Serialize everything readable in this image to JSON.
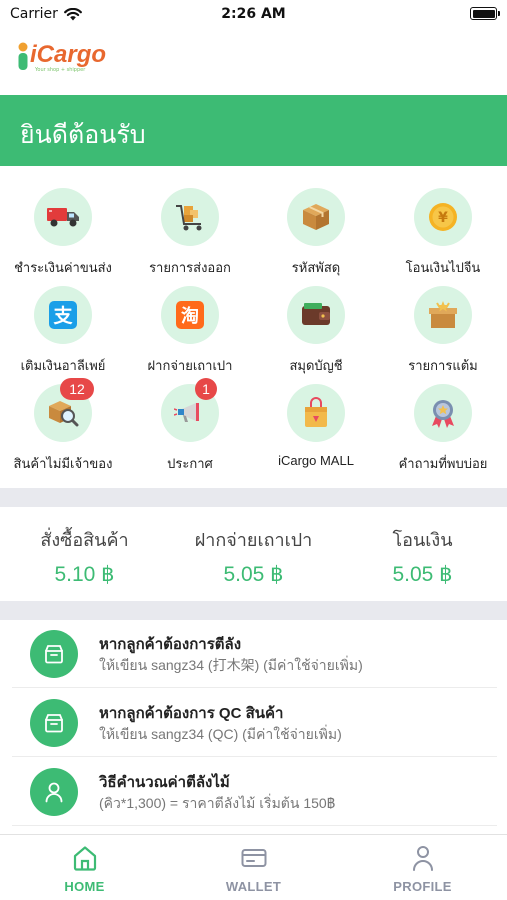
{
  "status_bar": {
    "carrier": "Carrier",
    "time": "2:26 AM"
  },
  "logo": {
    "text": "iCargo",
    "tagline": "Your shop + shipper"
  },
  "banner": {
    "title": "ยินดีต้อนรับ"
  },
  "menu": [
    {
      "label": "ชำระเงินค่าขนส่ง",
      "icon": "truck-icon"
    },
    {
      "label": "รายการส่งออก",
      "icon": "cart-icon"
    },
    {
      "label": "รหัสพัสดุ",
      "icon": "parcel-box-icon"
    },
    {
      "label": "โอนเงินไปจีน",
      "icon": "yuan-coin-icon"
    },
    {
      "label": "เติมเงินอาลีเพย์",
      "icon": "alipay-icon"
    },
    {
      "label": "ฝากจ่ายเถาเปา",
      "icon": "taobao-icon"
    },
    {
      "label": "สมุดบัญชี",
      "icon": "wallet-icon"
    },
    {
      "label": "รายการแต้ม",
      "icon": "gift-icon"
    },
    {
      "label": "สินค้าไม่มีเจ้าของ",
      "icon": "box-search-icon",
      "badge": "12"
    },
    {
      "label": "ประกาศ",
      "icon": "megaphone-icon",
      "badge": "1"
    },
    {
      "label": "iCargo MALL",
      "icon": "shopping-bag-icon"
    },
    {
      "label": "คำถามที่พบบ่อย",
      "icon": "medal-icon"
    }
  ],
  "rates": [
    {
      "label": "สั่งซื้อสินค้า",
      "value": "5.10 ฿"
    },
    {
      "label": "ฝากจ่ายเถาเปา",
      "value": "5.05 ฿"
    },
    {
      "label": "โอนเงิน",
      "value": "5.05 ฿"
    }
  ],
  "info": [
    {
      "title": "หากลูกค้าต้องการตีลัง",
      "sub": "ให้เขียน sangz34 (打木架) (มีค่าใช้จ่ายเพิ่ม)",
      "icon": "box-outline-icon"
    },
    {
      "title": "หากลูกค้าต้องการ QC สินค้า",
      "sub": "ให้เขียน sangz34 (QC) (มีค่าใช้จ่ายเพิ่ม)",
      "icon": "box-outline-icon"
    },
    {
      "title": "วิธีคำนวณค่าตีลังไม้",
      "sub": "(คิว*1,300) = ราคาตีลังไม้ เริ่มต้น 150฿",
      "icon": "person-outline-icon"
    }
  ],
  "tabs": [
    {
      "label": "HOME",
      "icon": "home-icon",
      "active": true
    },
    {
      "label": "WALLET",
      "icon": "wallet-card-icon",
      "active": false
    },
    {
      "label": "PROFILE",
      "icon": "profile-icon",
      "active": false
    }
  ],
  "colors": {
    "brand_green": "#3dbb74",
    "brand_orange": "#e8682f",
    "badge_red": "#e74848",
    "icon_bg": "#d9f4e3"
  }
}
